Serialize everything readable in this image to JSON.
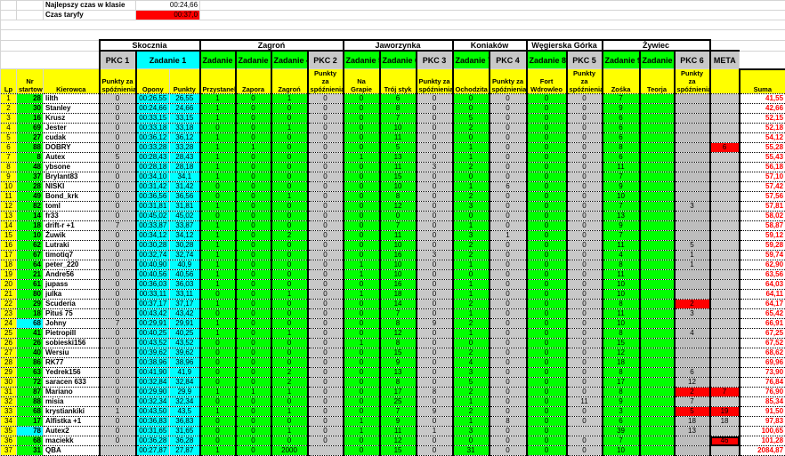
{
  "info": {
    "best_time_label": "Najlepszy czas w klasie",
    "best_time_value": "00:24,66",
    "tariff_time_label": "Czas taryfy",
    "tariff_time_value": "00:37,0"
  },
  "groups": [
    "Skocznia",
    "Zagroń",
    "Jaworzynka",
    "Koniaków",
    "Węgierska Górka",
    "Żywiec"
  ],
  "subheaders": [
    "PKC 1",
    "Zadanie 1",
    "Zadanie 2",
    "Zadanie 3",
    "Zadanie 4",
    "PKC 2",
    "Zadanie 5",
    "Zadanie 6",
    "PKC 3",
    "Zadanie 7",
    "PKC 4",
    "Zadanie 8",
    "PKC 5",
    "Zadanie 9",
    "Zadanie 9",
    "PKC 6",
    "META"
  ],
  "columns": [
    "Lp",
    "Nr startowy",
    "Kierowca",
    "Punkty za spóźnienia",
    "Opony",
    "Punkty",
    "Przystanek",
    "Zapora",
    "Zagroń",
    "Punkty za spóźnienia",
    "Na Grapie",
    "Trój styk",
    "Punkty za spóźnienia",
    "Ochodzita",
    "Punkty za spóźnienia",
    "Fort Wdrowleo",
    "Punkty za spóźnienia",
    "Zośka",
    "Teorja",
    "Punkty za spóźnienia",
    "",
    "Suma"
  ],
  "colors": {
    "yellow": "#ffff00",
    "green": "#00ff00",
    "cyan": "#00ffff",
    "gray": "#c8c8c8",
    "red": "#ff0000"
  },
  "rows": [
    [
      "1",
      "28",
      "lilth",
      "0",
      "00:26,55",
      "26,55",
      "1",
      "0",
      "1",
      "0",
      "0",
      "6",
      "0",
      "0",
      "0",
      "0",
      "0",
      "7",
      "",
      "",
      "",
      "41,55"
    ],
    [
      "2",
      "30",
      "Stanley",
      "0",
      "00:24,66",
      "24,66",
      "1",
      "0",
      "0",
      "0",
      "0",
      "8",
      "0",
      "0",
      "0",
      "0",
      "0",
      "9",
      "",
      "",
      "",
      "42,66"
    ],
    [
      "3",
      "16",
      "Krusz",
      "0",
      "00:33,15",
      "33,15",
      "1",
      "0",
      "0",
      "0",
      "0",
      "7",
      "0",
      "5",
      "0",
      "0",
      "0",
      "6",
      "",
      "",
      "",
      "52,15"
    ],
    [
      "4",
      "69",
      "Jester",
      "0",
      "00:33,18",
      "33,18",
      "0",
      "0",
      "1",
      "0",
      "0",
      "10",
      "0",
      "2",
      "0",
      "0",
      "0",
      "6",
      "",
      "",
      "",
      "52,18"
    ],
    [
      "5",
      "27",
      "cudak",
      "0",
      "00:36,12",
      "36,12",
      "1",
      "0",
      "0",
      "0",
      "0",
      "11",
      "0",
      "0",
      "0",
      "0",
      "0",
      "6",
      "",
      "",
      "",
      "54,12"
    ],
    [
      "6",
      "88",
      "DOBRY",
      "0",
      "00:33,28",
      "33,28",
      "1",
      "1",
      "0",
      "0",
      "0",
      "5",
      "0",
      "1",
      "0",
      "0",
      "0",
      "8",
      "",
      "",
      "6",
      "55,28"
    ],
    [
      "7",
      "8",
      "Autex",
      "5",
      "00:28,43",
      "28,43",
      "1",
      "0",
      "0",
      "0",
      "1",
      "13",
      "0",
      "1",
      "0",
      "0",
      "0",
      "6",
      "",
      "",
      "",
      "55,43"
    ],
    [
      "8",
      "48",
      "ybsone",
      "0",
      "00:28,18",
      "28,18",
      "1",
      "0",
      "0",
      "0",
      "0",
      "11",
      "3",
      "2",
      "0",
      "0",
      "0",
      "11",
      "",
      "",
      "",
      "56,18"
    ],
    [
      "9",
      "37",
      "Brylant83",
      "0",
      "00:34,10",
      "34,1",
      "1",
      "0",
      "0",
      "0",
      "0",
      "15",
      "0",
      "0",
      "0",
      "0",
      "0",
      "7",
      "",
      "",
      "",
      "57,10"
    ],
    [
      "10",
      "28",
      "NISKI",
      "0",
      "00:31,42",
      "31,42",
      "0",
      "0",
      "0",
      "0",
      "0",
      "10",
      "0",
      "1",
      "6",
      "0",
      "0",
      "9",
      "",
      "",
      "",
      "57,42"
    ],
    [
      "11",
      "49",
      "Bond_krk",
      "0",
      "00:36,56",
      "36,56",
      "0",
      "0",
      "1",
      "0",
      "0",
      "8",
      "0",
      "2",
      "0",
      "0",
      "0",
      "10",
      "",
      "",
      "",
      "57,56"
    ],
    [
      "12",
      "82",
      "toml",
      "0",
      "00:31,81",
      "31,81",
      "1",
      "0",
      "0",
      "0",
      "0",
      "12",
      "0",
      "3",
      "0",
      "0",
      "0",
      "7",
      "",
      "3",
      "",
      "57,81"
    ],
    [
      "13",
      "14",
      "fr33",
      "0",
      "00:45,02",
      "45,02",
      "0",
      "0",
      "0",
      "0",
      "0",
      "0",
      "0",
      "0",
      "0",
      "0",
      "0",
      "13",
      "",
      "",
      "",
      "58,02"
    ],
    [
      "14",
      "18",
      "drift-r +1",
      "7",
      "00:33,87",
      "33,87",
      "1",
      "0",
      "0",
      "0",
      "0",
      "7",
      "0",
      "1",
      "0",
      "0",
      "0",
      "9",
      "",
      "",
      "",
      "58,87"
    ],
    [
      "15",
      "10",
      "Żuwik",
      "0",
      "00:34,12",
      "34,12",
      "1",
      "0",
      "2",
      "0",
      "0",
      "11",
      "0",
      "3",
      "1",
      "0",
      "0",
      "7",
      "",
      "",
      "",
      "59,12"
    ],
    [
      "16",
      "62",
      "Lutraki",
      "0",
      "00:30,28",
      "30,28",
      "1",
      "0",
      "0",
      "0",
      "0",
      "10",
      "0",
      "2",
      "0",
      "0",
      "0",
      "11",
      "",
      "5",
      "",
      "59,28"
    ],
    [
      "17",
      "67",
      "timotiq7",
      "0",
      "00:32,74",
      "32,74",
      "1",
      "0",
      "0",
      "0",
      "0",
      "16",
      "3",
      "2",
      "0",
      "0",
      "0",
      "4",
      "",
      "1",
      "",
      "59,74"
    ],
    [
      "18",
      "64",
      "peter_220",
      "0",
      "00:40,90",
      "40,9",
      "1",
      "0",
      "0",
      "0",
      "1",
      "10",
      "0",
      "1",
      "0",
      "0",
      "0",
      "8",
      "",
      "1",
      "",
      "62,90"
    ],
    [
      "19",
      "21",
      "Andre56",
      "0",
      "00:40,56",
      "40,56",
      "1",
      "0",
      "0",
      "0",
      "1",
      "10",
      "0",
      "0",
      "0",
      "0",
      "0",
      "11",
      "",
      "",
      "",
      "63,56"
    ],
    [
      "20",
      "61",
      "jupass",
      "0",
      "00:36,03",
      "36,03",
      "1",
      "0",
      "0",
      "0",
      "0",
      "16",
      "0",
      "1",
      "0",
      "0",
      "0",
      "10",
      "",
      "",
      "",
      "64,03"
    ],
    [
      "21",
      "80",
      "julka",
      "0",
      "00:33,11",
      "33,11",
      "0",
      "0",
      "1",
      "0",
      "1",
      "18",
      "0",
      "1",
      "0",
      "0",
      "0",
      "10",
      "",
      "",
      "",
      "64,11"
    ],
    [
      "22",
      "29",
      "Scuderia",
      "0",
      "00:37,17",
      "37,17",
      "1",
      "0",
      "0",
      "0",
      "0",
      "14",
      "0",
      "2",
      "0",
      "0",
      "0",
      "8",
      "",
      "2",
      "",
      "64,17"
    ],
    [
      "23",
      "18",
      "Pituś 75",
      "0",
      "00:43,42",
      "43,42",
      "0",
      "0",
      "0",
      "0",
      "0",
      "7",
      "0",
      "1",
      "0",
      "0",
      "0",
      "11",
      "",
      "3",
      "",
      "65,42"
    ],
    [
      "24",
      "68",
      "Johny",
      "7",
      "00:29,91",
      "29,91",
      "1",
      "0",
      "0",
      "0",
      "0",
      "8",
      "9",
      "2",
      "0",
      "0",
      "0",
      "10",
      "",
      "",
      "",
      "66,91"
    ],
    [
      "25",
      "41",
      "Pietropill",
      "0",
      "00:40,25",
      "40,25",
      "1",
      "0",
      "1",
      "0",
      "0",
      "12",
      "0",
      "1",
      "0",
      "0",
      "0",
      "8",
      "",
      "4",
      "",
      "67,25"
    ],
    [
      "26",
      "26",
      "sobieski156",
      "0",
      "00:43,52",
      "43,52",
      "0",
      "0",
      "0",
      "0",
      "1",
      "8",
      "0",
      "0",
      "0",
      "0",
      "0",
      "15",
      "",
      "",
      "",
      "67,52"
    ],
    [
      "27",
      "40",
      "Wersiu",
      "0",
      "00:39,62",
      "39,62",
      "0",
      "0",
      "0",
      "0",
      "0",
      "15",
      "0",
      "2",
      "0",
      "0",
      "0",
      "12",
      "",
      "",
      "",
      "68,62"
    ],
    [
      "28",
      "86",
      "RK77",
      "0",
      "00:38,96",
      "38,96",
      "0",
      "0",
      "0",
      "0",
      "0",
      "9",
      "0",
      "4",
      "0",
      "0",
      "0",
      "18",
      "",
      "",
      "",
      "69,96"
    ],
    [
      "29",
      "63",
      "Yedrek156",
      "0",
      "00:41,90",
      "41,9",
      "0",
      "0",
      "2",
      "0",
      "0",
      "13",
      "0",
      "3",
      "0",
      "0",
      "0",
      "8",
      "",
      "6",
      "",
      "73,90"
    ],
    [
      "30",
      "72",
      "saracen 633",
      "0",
      "00:32,84",
      "32,84",
      "0",
      "0",
      "2",
      "0",
      "0",
      "8",
      "0",
      "5",
      "0",
      "0",
      "0",
      "17",
      "",
      "12",
      "",
      "76,84"
    ],
    [
      "31",
      "87",
      "Mariano",
      "0",
      "00:29,90",
      "29,9",
      "1",
      "1",
      "1",
      "0",
      "0",
      "17",
      "8",
      "2",
      "0",
      "0",
      "0",
      "8",
      "",
      "2",
      "7",
      "76,90"
    ],
    [
      "32",
      "88",
      "misia",
      "0",
      "00:32,34",
      "32,34",
      "0",
      "0",
      "0",
      "0",
      "0",
      "25",
      "0",
      "1",
      "0",
      "0",
      "11",
      "9",
      "",
      "7",
      "",
      "85,34"
    ],
    [
      "33",
      "68",
      "krystiankiki",
      "1",
      "00:43,50",
      "43,5",
      "1",
      "0",
      "1",
      "0",
      "0",
      "7",
      "9",
      "2",
      "0",
      "0",
      "0",
      "3",
      "",
      "5",
      "19",
      "91,50"
    ],
    [
      "34",
      "17",
      "Alfistka +1",
      "0",
      "00:36,83",
      "36,83",
      "0",
      "0",
      "0",
      "0",
      "1",
      "9",
      "0",
      "1",
      "8",
      "0",
      "0",
      "6",
      "",
      "18",
      "18",
      "97,83"
    ],
    [
      "35",
      "78",
      "Autex2",
      "0",
      "00:31,65",
      "31,65",
      "0",
      "0",
      "1",
      "0",
      "1",
      "11",
      "1",
      "3",
      "0",
      "0",
      "",
      "39",
      "",
      "13",
      "",
      "100,65"
    ],
    [
      "36",
      "68",
      "maciekk",
      "0",
      "00:36,28",
      "36,28",
      "0",
      "0",
      "0",
      "0",
      "0",
      "12",
      "0",
      "0",
      "0",
      "0",
      "0",
      "7",
      "",
      "",
      "46",
      "101,28"
    ],
    [
      "37",
      "31",
      "QBA",
      "",
      "00:27,87",
      "27,87",
      "1",
      "0",
      "2000",
      "",
      "0",
      "15",
      "0",
      "31",
      "0",
      "0",
      "0",
      "10",
      "",
      "",
      "",
      "2084,87"
    ]
  ],
  "red_cells": [
    [
      6,
      20
    ],
    [
      22,
      19
    ],
    [
      31,
      19
    ],
    [
      31,
      20
    ],
    [
      33,
      19
    ],
    [
      33,
      20
    ],
    [
      36,
      20
    ]
  ],
  "cyan_nr_rows": [
    24,
    35
  ],
  "selected_cell": [
    36,
    20
  ]
}
